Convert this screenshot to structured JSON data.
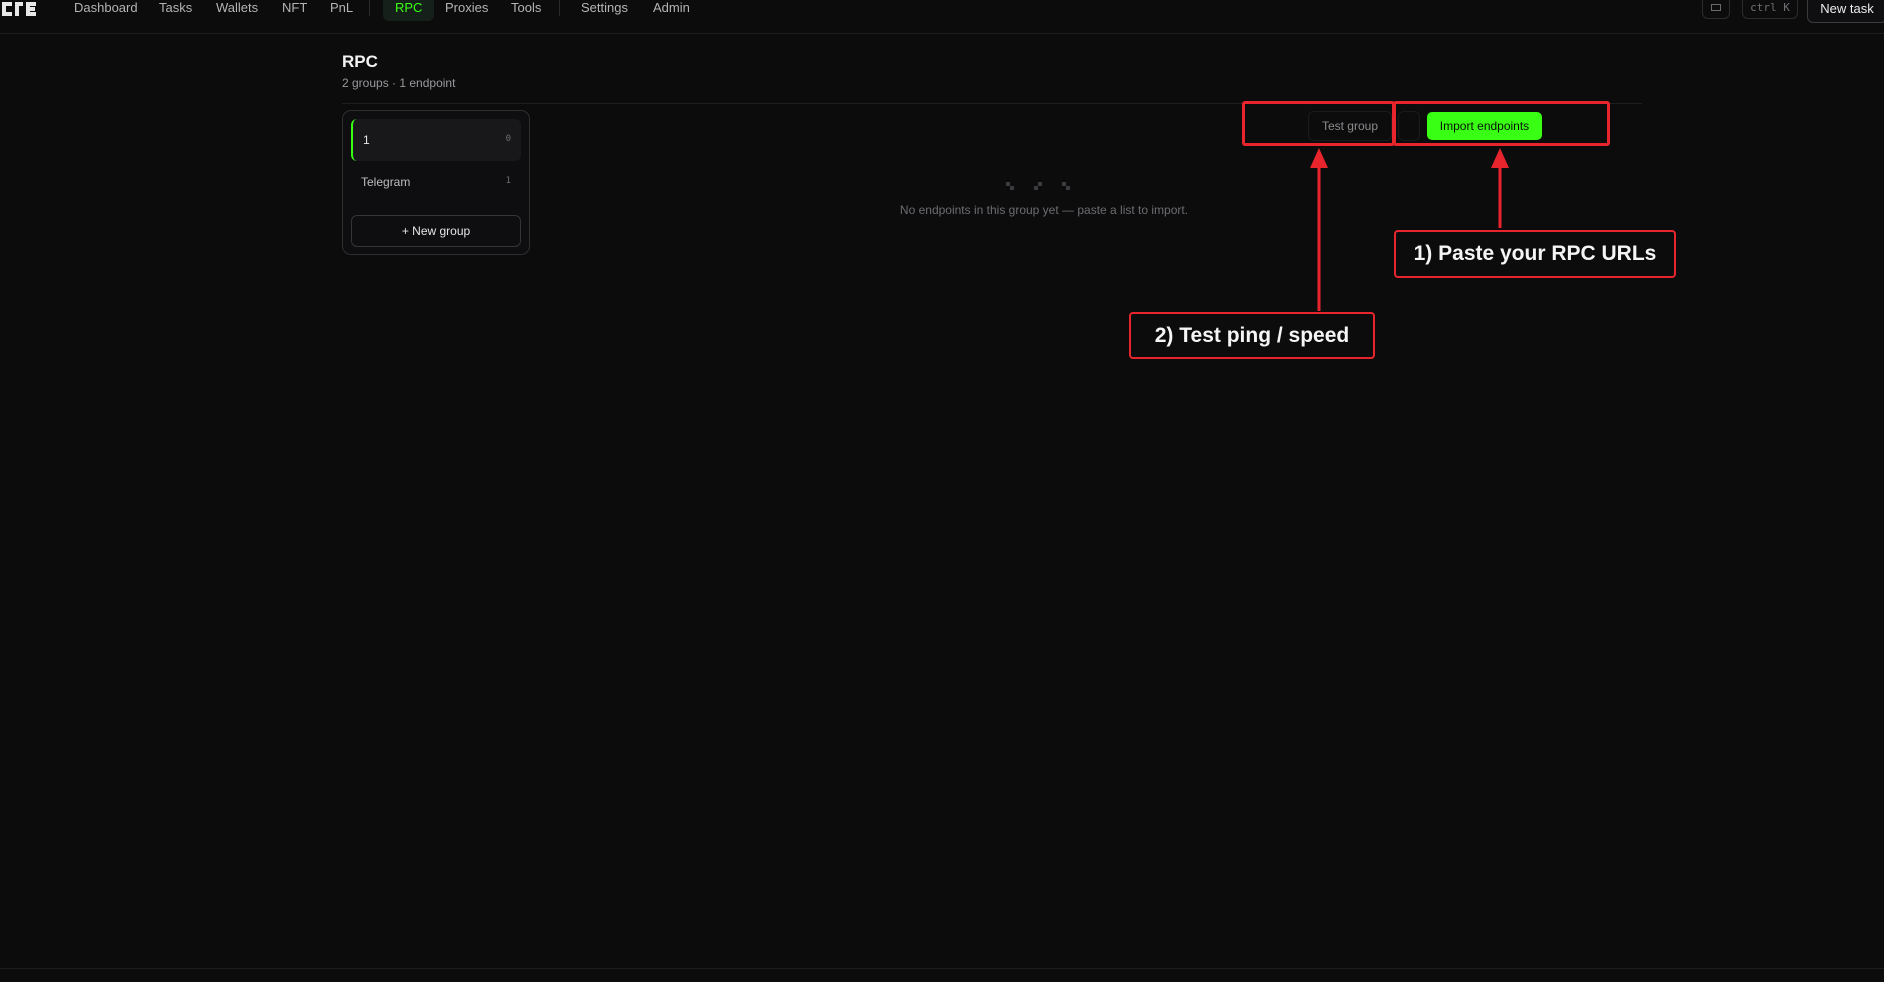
{
  "nav": {
    "items": [
      {
        "label": "Dashboard"
      },
      {
        "label": "Tasks"
      },
      {
        "label": "Wallets"
      },
      {
        "label": "NFT"
      },
      {
        "label": "PnL"
      },
      {
        "label": "RPC",
        "active": true
      },
      {
        "label": "Proxies"
      },
      {
        "label": "Tools"
      },
      {
        "label": "Settings"
      },
      {
        "label": "Admin"
      }
    ],
    "shortcut_hint": "ctrl K",
    "new_task_label": "New task",
    "layout_icon": "sidebar-layout-icon",
    "accent_color": "#39ff14"
  },
  "page": {
    "title": "RPC",
    "subtitle": "2 groups · 1 endpoint"
  },
  "groups": {
    "items": [
      {
        "name": "1",
        "count": "0",
        "selected": true
      },
      {
        "name": "Telegram",
        "count": "1",
        "selected": false
      }
    ],
    "new_group_label": "+ New group"
  },
  "empty_state": {
    "icon": "empty-dots-icon",
    "text": "No endpoints in this group yet — paste a list to import."
  },
  "actions": {
    "test_group_label": "Test group",
    "import_label": "Import endpoints"
  },
  "annotations": {
    "color": "#e8242d",
    "step1": "1) Paste your RPC URLs",
    "step2": "2) Test ping / speed"
  }
}
